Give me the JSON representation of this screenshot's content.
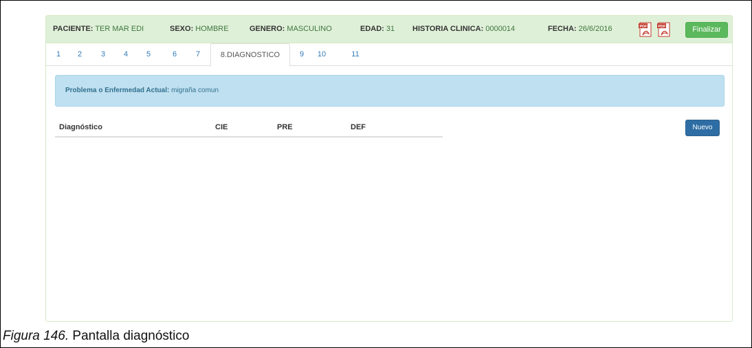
{
  "patient_bar": {
    "paciente_label": "PACIENTE:",
    "paciente_value": "TER MAR EDI",
    "sexo_label": "SEXO:",
    "sexo_value": "HOMBRE",
    "genero_label": "GENERO:",
    "genero_value": "MASCULINO",
    "edad_label": "EDAD:",
    "edad_value": "31",
    "historia_label": "HISTORIA CLINICA:",
    "historia_value": "0000014",
    "fecha_label": "FECHA:",
    "fecha_value": "26/6/2016",
    "pdf_icons": [
      "pdf-icon",
      "pdf-icon"
    ],
    "finalizar_label": "Finalizar"
  },
  "tabs": [
    {
      "label": "1"
    },
    {
      "label": "2"
    },
    {
      "label": "3"
    },
    {
      "label": "4"
    },
    {
      "label": "5"
    },
    {
      "label": "6"
    },
    {
      "label": "7"
    },
    {
      "label": "8.DIAGNOSTICO",
      "active": true
    },
    {
      "label": "9"
    },
    {
      "label": "10"
    },
    {
      "label": "11"
    }
  ],
  "alert": {
    "label": "Problema o Enfermedad Actual:",
    "value": "migraña comun"
  },
  "table": {
    "columns": [
      "Diagnóstico",
      "CIE",
      "PRE",
      "DEF"
    ]
  },
  "nuevo_label": "Nuevo",
  "caption": {
    "figure": "Figura 146.",
    "text": "Pantalla diagnóstico"
  },
  "colors": {
    "success": "#5cb85c",
    "primary": "#2e6da4",
    "info_bg": "#bfe0f0",
    "header_bg": "#dff0d8",
    "link": "#337ab7"
  }
}
